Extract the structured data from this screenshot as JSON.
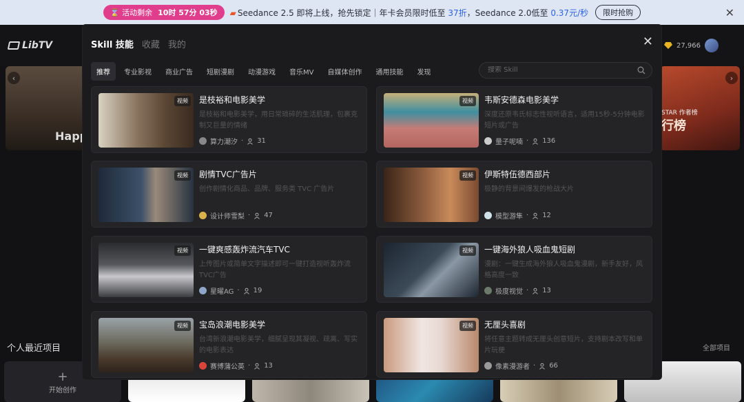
{
  "banner": {
    "promo_label": "活动剩余",
    "countdown": "10时 57分 03秒",
    "message_prefix": "Seedance 2.5 即将上线，抢先锁定｜年卡会员限时低至",
    "discount": "37折",
    "message_mid": "，Seedance 2.0低至",
    "price": "0.37元/秒",
    "cta": "限时抢购",
    "accent": "#e03d8c"
  },
  "app": {
    "logo": "LibTV",
    "credits": "27,966"
  },
  "background": {
    "left_text": "Happ",
    "right_text_1": "STAR 作者榜",
    "right_text_2": "行榜",
    "recent_title": "个人最近项目",
    "recent_all": "全部项目",
    "new_project": "开始创作"
  },
  "modal": {
    "header_tabs": [
      "Skill 技能",
      "收藏",
      "我的"
    ],
    "categories": [
      "推荐",
      "专业影视",
      "商业广告",
      "短剧漫剧",
      "动漫游戏",
      "音乐MV",
      "自媒体创作",
      "通用技能",
      "发现"
    ],
    "search_placeholder": "搜索 Skill",
    "badge": "视频",
    "cards": [
      {
        "title": "是枝裕和电影美学",
        "desc": "是枝裕和电影美学，用日常琐碎的生活肌理，包裹克制又巨量的情绪",
        "author": "算力潮汐",
        "count": "31"
      },
      {
        "title": "韦斯安德森电影美学",
        "desc": "深度还原韦氏标志性视听语言，适用15秒-5分钟电影短片或广告",
        "author": "量子呢喃",
        "count": "136"
      },
      {
        "title": "剧情TVC广告片",
        "desc": "创作剧情化商品、品牌、服务类 TVC 广告片",
        "author": "设计师雪梨",
        "count": "47"
      },
      {
        "title": "伊斯特伍德西部片",
        "desc": "极静的背景间爆发的枪战大片",
        "author": "模型游隼",
        "count": "12"
      },
      {
        "title": "一键爽感轰炸流汽车TVC",
        "desc": "上传图片或简单文字描述即可一键打造视听轰炸流TVC广告",
        "author": "星曜AG",
        "count": "19"
      },
      {
        "title": "一键海外狼人吸血鬼短剧",
        "desc": "漫剧：一键生成海外狼人吸血鬼漫剧，新手友好，风格高度一致",
        "author": "极度视觉",
        "count": "13"
      },
      {
        "title": "宝岛浪潮电影美学",
        "desc": "台湾新浪潮电影美学，细腻呈现其凝视、疏离、写实的电影表达",
        "author": "赛博蒲公英",
        "count": "13"
      },
      {
        "title": "无厘头喜剧",
        "desc": "将任意主题转成无厘头创意短片，支持剧本改写和单片玩梗",
        "author": "像素漫游者",
        "count": "66"
      }
    ]
  }
}
